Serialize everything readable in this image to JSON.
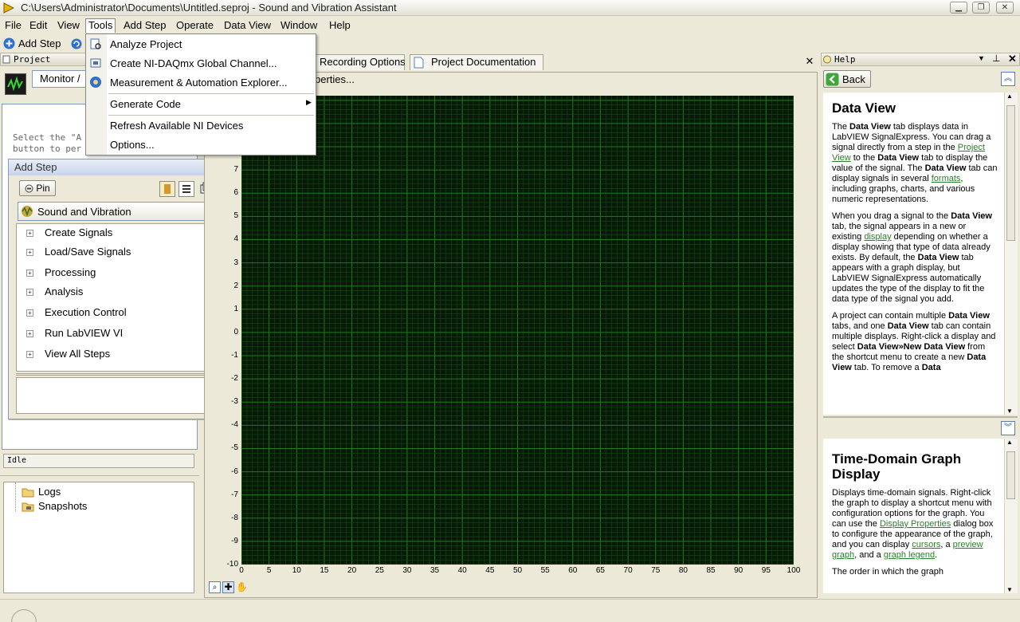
{
  "window": {
    "title": "C:\\Users\\Administrator\\Documents\\Untitled.seproj - Sound and Vibration Assistant"
  },
  "menubar": {
    "items": [
      "File",
      "Edit",
      "View",
      "Tools",
      "Add Step",
      "Operate",
      "Data View",
      "Window",
      "Help"
    ]
  },
  "toolbar": {
    "add_step_label": "Add Step"
  },
  "tools_menu": {
    "items": [
      "Analyze Project",
      "Create NI-DAQmx Global Channel...",
      "Measurement & Automation Explorer...",
      "Generate Code",
      "Refresh Available NI Devices",
      "Options..."
    ]
  },
  "project_panel": {
    "header": "Project",
    "monitor_label": "Monitor /",
    "monitor_message": "Select the \"A\nbutton to per",
    "status": "Idle",
    "tree": [
      "Logs",
      "Snapshots"
    ]
  },
  "add_step": {
    "title": "Add Step",
    "pin_label": "Pin",
    "category": "Sound and Vibration",
    "items": [
      "Create Signals",
      "Load/Save Signals",
      "Processing",
      "Analysis",
      "Execution Control",
      "Run LabVIEW VI",
      "View All Steps"
    ]
  },
  "doc_tabs": {
    "tabs": [
      "Recording Options",
      "Project Documentation"
    ],
    "properties_fragment": "perties..."
  },
  "graph": {
    "y_ticks": [
      "7",
      "6",
      "5",
      "4",
      "3",
      "2",
      "1",
      "0",
      "-1",
      "-2",
      "-3",
      "-4",
      "-5",
      "-6",
      "-7",
      "-8",
      "-9",
      "-10"
    ],
    "x_ticks": [
      "0",
      "5",
      "10",
      "15",
      "20",
      "25",
      "30",
      "35",
      "40",
      "45",
      "50",
      "55",
      "60",
      "65",
      "70",
      "75",
      "80",
      "85",
      "90",
      "95",
      "100"
    ]
  },
  "help": {
    "header": "Help",
    "back_label": "Back",
    "section1": {
      "title": "Data View",
      "p1": [
        "The ",
        "Data View",
        " tab displays data in LabVIEW SignalExpress. You can drag a signal directly from a step in the ",
        "Project View",
        " to the ",
        "Data View",
        " tab to display the value of the signal. The ",
        "Data View",
        " tab can display signals in several ",
        "formats",
        ", including graphs, charts, and various numeric representations."
      ],
      "p2": [
        "When you drag a signal to the ",
        "Data View",
        " tab, the signal appears in a new or existing ",
        "display",
        " depending on whether a display showing that type of data already exists. By default, the ",
        "Data View",
        " tab appears with a graph display, but LabVIEW SignalExpress automatically updates the type of the display to fit the data type of the signal you add."
      ],
      "p3": [
        "A project can contain multiple ",
        "Data View",
        " tabs, and one ",
        "Data View",
        " tab can contain multiple displays. Right-click a display and select ",
        "Data View»New Data View",
        " from the shortcut menu to create a new ",
        "Data View",
        " tab. To remove a ",
        "Data"
      ]
    },
    "section2": {
      "title": "Time-Domain Graph Display",
      "p1": [
        "Displays time-domain signals. Right-click the graph to display a shortcut menu with configuration options for the graph. You can use the ",
        "Display Properties",
        " dialog box to configure the appearance of the graph, and you can display ",
        "cursors",
        ", a ",
        "preview graph",
        ", and a ",
        "graph legend",
        "."
      ],
      "p2": "The order in which the graph"
    }
  }
}
